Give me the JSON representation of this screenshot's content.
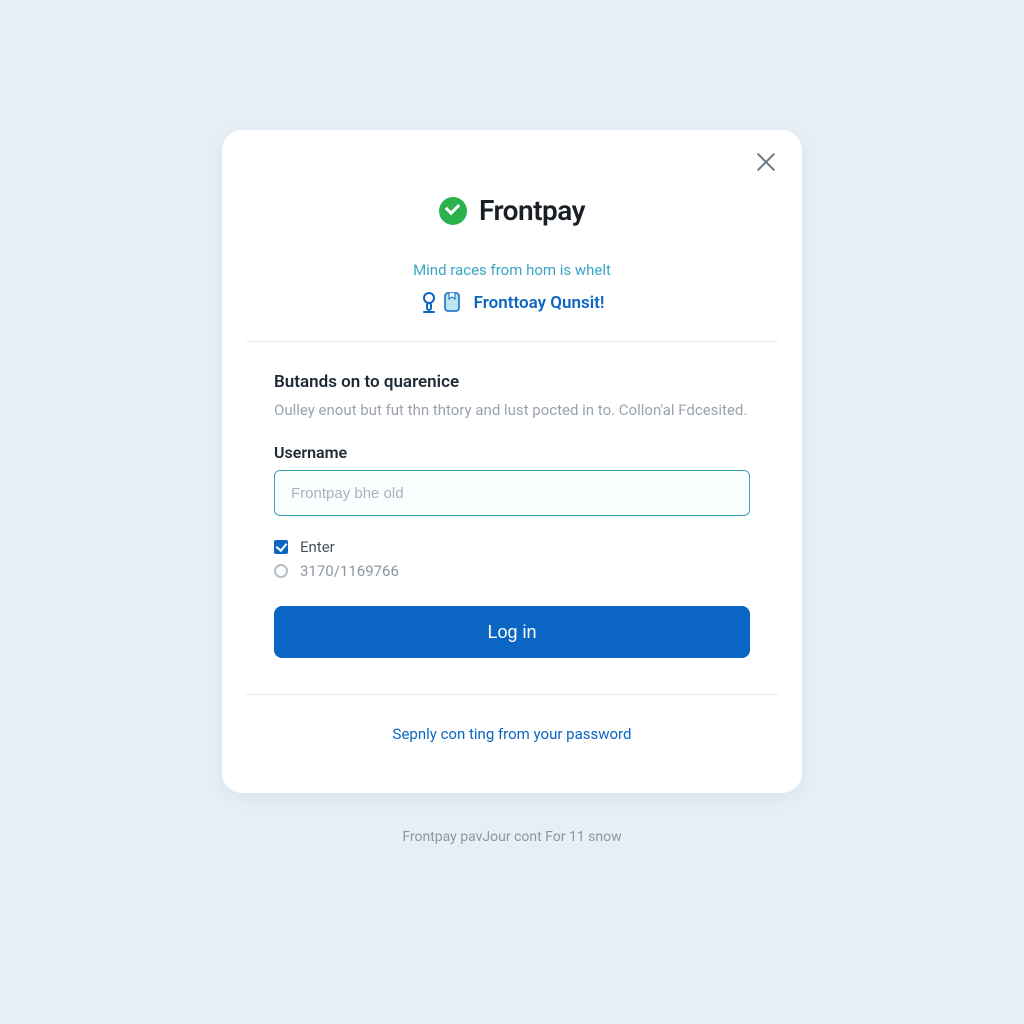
{
  "brand": {
    "name": "Frontpay"
  },
  "tagline": "Mind races from hom is whelt",
  "promo": {
    "text": "Fronttoay Qunsit!"
  },
  "intro": {
    "title": "Butands on to quarenice",
    "subtitle": "Oulley enout but fut thn thtory and lust pocted in to. Collon'al Fdcesited."
  },
  "username": {
    "label": "Username",
    "placeholder": "Frontpay bhe old",
    "value": ""
  },
  "choices": {
    "enter_label": "Enter",
    "alt_label": "3170/1169766"
  },
  "actions": {
    "login": "Log in",
    "forgot": "Sepnly con ting from your password"
  },
  "footer": "Frontpay pavJour cont For 11 snow"
}
